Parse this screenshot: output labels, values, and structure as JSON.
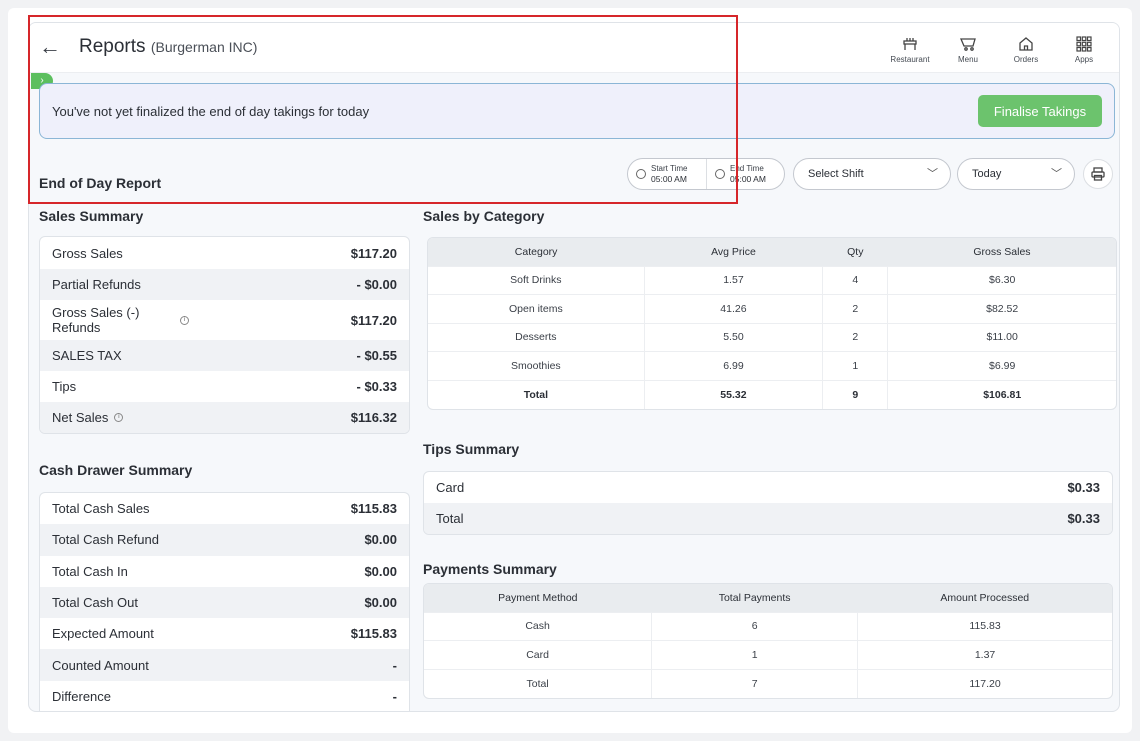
{
  "header": {
    "title": "Reports",
    "subtitle": "(Burgerman INC)",
    "nav": [
      {
        "label": "Restaurant",
        "icon": "restaurant-icon"
      },
      {
        "label": "Menu",
        "icon": "menu-icon"
      },
      {
        "label": "Orders",
        "icon": "orders-icon"
      },
      {
        "label": "Apps",
        "icon": "apps-icon"
      }
    ]
  },
  "banner": {
    "message": "You've not yet finalized the end of day takings for today",
    "button_label": "Finalise Takings"
  },
  "report": {
    "title": "End of Day Report",
    "start_time_label": "Start Time",
    "start_time_value": "05:00 AM",
    "end_time_label": "End Time",
    "end_time_value": "05:00 AM",
    "shift_placeholder": "Select Shift",
    "day_value": "Today"
  },
  "sales_summary": {
    "title": "Sales Summary",
    "rows": [
      {
        "label": "Gross Sales",
        "value": "$117.20"
      },
      {
        "label": "Partial Refunds",
        "value": "- $0.00"
      },
      {
        "label": "Gross Sales (-) Refunds",
        "value": "$117.20"
      },
      {
        "label": "SALES TAX",
        "value": "- $0.55"
      },
      {
        "label": "Tips",
        "value": "- $0.33"
      },
      {
        "label": "Net Sales",
        "value": "$116.32"
      }
    ]
  },
  "cash_drawer": {
    "title": "Cash Drawer Summary",
    "rows": [
      {
        "label": "Total Cash Sales",
        "value": "$115.83"
      },
      {
        "label": "Total Cash Refund",
        "value": "$0.00"
      },
      {
        "label": "Total Cash In",
        "value": "$0.00"
      },
      {
        "label": "Total Cash Out",
        "value": "$0.00"
      },
      {
        "label": "Expected Amount",
        "value": "$115.83"
      },
      {
        "label": "Counted Amount",
        "value": "-"
      },
      {
        "label": "Difference",
        "value": "-"
      }
    ]
  },
  "sales_by_category": {
    "title": "Sales by Category",
    "columns": [
      "Category",
      "Avg Price",
      "Qty",
      "Gross Sales"
    ],
    "rows": [
      [
        "Soft Drinks",
        "1.57",
        "4",
        "$6.30"
      ],
      [
        "Open items",
        "41.26",
        "2",
        "$82.52"
      ],
      [
        "Desserts",
        "5.50",
        "2",
        "$11.00"
      ],
      [
        "Smoothies",
        "6.99",
        "1",
        "$6.99"
      ],
      [
        "Total",
        "55.32",
        "9",
        "$106.81"
      ]
    ]
  },
  "tips_summary": {
    "title": "Tips Summary",
    "rows": [
      {
        "label": "Card",
        "value": "$0.33"
      },
      {
        "label": "Total",
        "value": "$0.33"
      }
    ]
  },
  "payments_summary": {
    "title": "Payments Summary",
    "columns": [
      "Payment Method",
      "Total Payments",
      "Amount Processed"
    ],
    "rows": [
      [
        "Cash",
        "6",
        "115.83"
      ],
      [
        "Card",
        "1",
        "1.37"
      ],
      [
        "Total",
        "7",
        "117.20"
      ]
    ]
  },
  "colors": {
    "accent_green": "#6cc36d",
    "banner_bg": "#eff0fb",
    "highlight_red": "#d6262a"
  }
}
